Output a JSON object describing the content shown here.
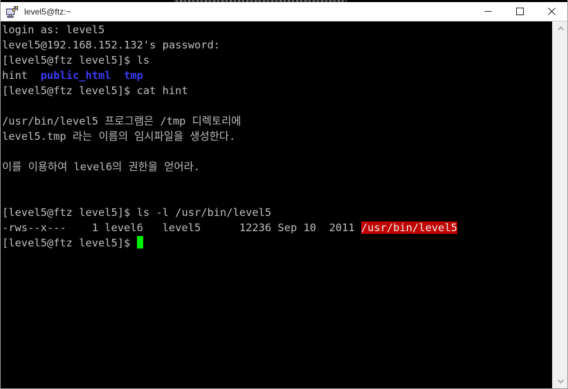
{
  "window": {
    "title": "level5@ftz:~",
    "icon": "putty-icon",
    "controls": {
      "minimize_label": "Minimize",
      "maximize_label": "Maximize",
      "close_label": "Close"
    }
  },
  "terminal": {
    "colors": {
      "background": "#000000",
      "foreground": "#bfbfbf",
      "directory_blue": "#3b3bf5",
      "setuid_red_bg": "#c00000",
      "cursor_green": "#00ee00"
    },
    "lines": [
      {
        "id": "l01",
        "segments": [
          {
            "text": "login as: level5",
            "style": "default"
          }
        ]
      },
      {
        "id": "l02",
        "segments": [
          {
            "text": "level5@192.168.152.132's password:",
            "style": "default"
          }
        ]
      },
      {
        "id": "l03",
        "segments": [
          {
            "text": "[level5@ftz level5]$ ls",
            "style": "default"
          }
        ]
      },
      {
        "id": "l04",
        "segments": [
          {
            "text": "hint  ",
            "style": "default"
          },
          {
            "text": "public_html",
            "style": "dir"
          },
          {
            "text": "  ",
            "style": "default"
          },
          {
            "text": "tmp",
            "style": "dir"
          }
        ]
      },
      {
        "id": "l05",
        "segments": [
          {
            "text": "[level5@ftz level5]$ cat hint",
            "style": "default"
          }
        ]
      },
      {
        "id": "l06",
        "segments": [
          {
            "text": "",
            "style": "default"
          }
        ]
      },
      {
        "id": "l07",
        "segments": [
          {
            "text": "/usr/bin/level5 프로그램은 /tmp 디렉토리에",
            "style": "default"
          }
        ]
      },
      {
        "id": "l08",
        "segments": [
          {
            "text": "level5.tmp 라는 이름의 임시파일을 생성한다.",
            "style": "default"
          }
        ]
      },
      {
        "id": "l09",
        "segments": [
          {
            "text": "",
            "style": "default"
          }
        ]
      },
      {
        "id": "l10",
        "segments": [
          {
            "text": "이를 이용하여 level6의 권한을 얻어라.",
            "style": "default"
          }
        ]
      },
      {
        "id": "l11",
        "segments": [
          {
            "text": "",
            "style": "default"
          }
        ]
      },
      {
        "id": "l12",
        "segments": [
          {
            "text": "",
            "style": "default"
          }
        ]
      },
      {
        "id": "l13",
        "segments": [
          {
            "text": "[level5@ftz level5]$ ls -l /usr/bin/level5",
            "style": "default"
          }
        ]
      },
      {
        "id": "l14",
        "segments": [
          {
            "text": "-rws--x---    1 level6   level5      12236 Sep 10  2011 ",
            "style": "default"
          },
          {
            "text": "/usr/bin/level5",
            "style": "setuid"
          }
        ]
      },
      {
        "id": "l15",
        "segments": [
          {
            "text": "[level5@ftz level5]$ ",
            "style": "default"
          }
        ],
        "cursor": true
      }
    ]
  },
  "scrollbar": {
    "up_arrow": "chevron-up-icon",
    "down_arrow": "chevron-down-icon"
  }
}
